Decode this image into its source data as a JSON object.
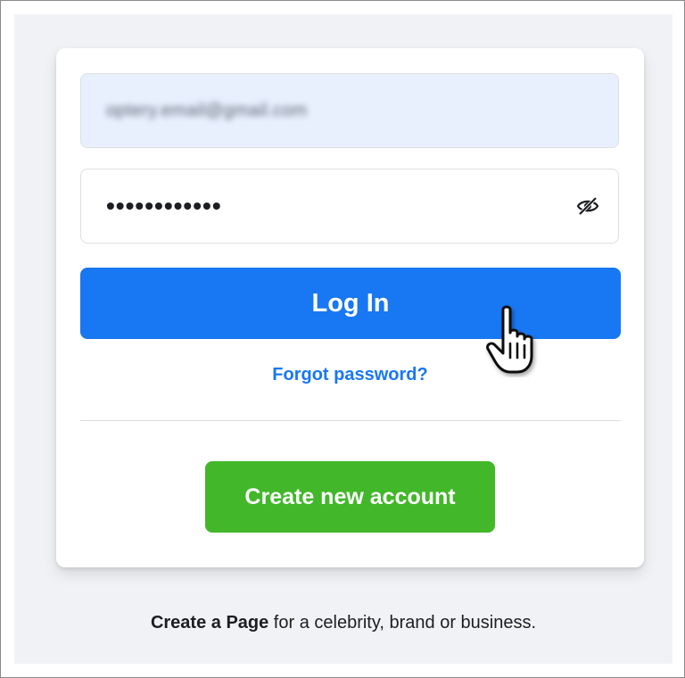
{
  "login_form": {
    "email_value": "optery.email@gmail.com",
    "password_value": "••••••••••••",
    "show_password_icon": "eye-slash-icon",
    "login_label": "Log In",
    "forgot_label": "Forgot password?",
    "create_label": "Create new account"
  },
  "footer": {
    "create_page_link": "Create a Page",
    "rest_text": " for a celebrity, brand or business."
  },
  "cursor": {
    "icon": "hand-pointer-icon"
  },
  "colors": {
    "primary": "#1877f2",
    "success": "#42b72a",
    "background": "#f0f2f5",
    "autofill": "#e8f0fe"
  }
}
